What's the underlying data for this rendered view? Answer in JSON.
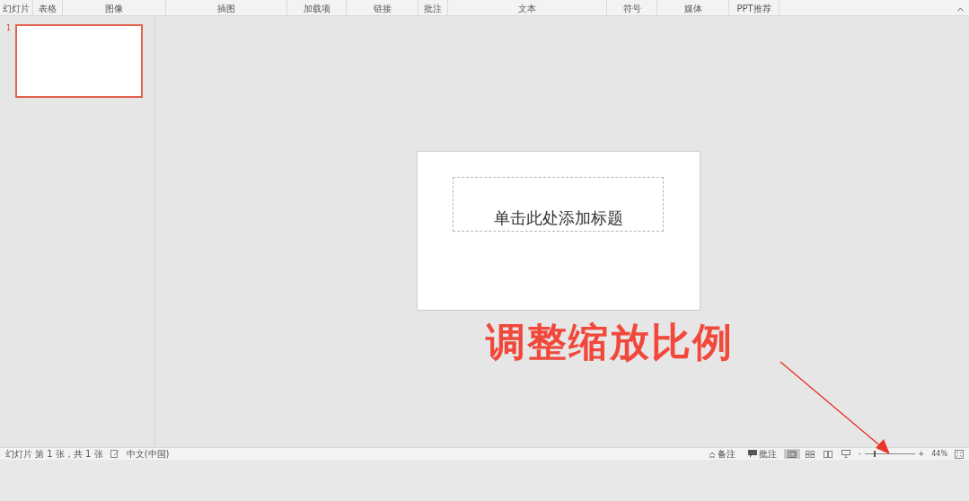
{
  "ribbon": {
    "groups": [
      {
        "label": "幻灯片"
      },
      {
        "label": "表格"
      },
      {
        "label": "图像"
      },
      {
        "label": "插图"
      },
      {
        "label": "加载项"
      },
      {
        "label": "链接"
      },
      {
        "label": "批注"
      },
      {
        "label": "文本"
      },
      {
        "label": "符号"
      },
      {
        "label": "媒体"
      },
      {
        "label": "PPT推荐"
      }
    ]
  },
  "thumbnails": [
    {
      "number": "1",
      "selected": true
    }
  ],
  "slide": {
    "title_placeholder": "单击此处添加标题"
  },
  "annotation": {
    "text": "调整缩放比例"
  },
  "status_bar": {
    "slide_info": "幻灯片 第 1 张，共 1 张",
    "language": "中文(中国)",
    "notes": "备注",
    "comments": "批注",
    "views": [
      {
        "kind": "normal",
        "selected": true
      },
      {
        "kind": "sorter",
        "selected": false
      },
      {
        "kind": "reading",
        "selected": false
      },
      {
        "kind": "show",
        "selected": false
      }
    ],
    "zoom": {
      "minus": "-",
      "plus": "+",
      "level": 0.2,
      "percent": "44%"
    }
  }
}
